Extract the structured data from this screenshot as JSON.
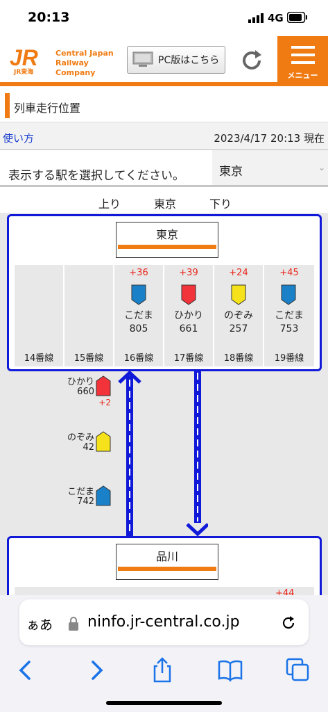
{
  "status": {
    "time": "20:13",
    "network": "4G"
  },
  "header": {
    "logo_text": "JR",
    "logo_sub": "JR東海",
    "company_line1": "Central Japan",
    "company_line2": "Railway Company",
    "pc_button": "PC版はこちら",
    "menu_label": "メニュー"
  },
  "page_title": "列車走行位置",
  "infobar": {
    "how_to": "使い方",
    "updated": "2023/4/17 20:13 現在"
  },
  "select": {
    "label": "表示する駅を選択してください。",
    "value": "東京"
  },
  "directions": {
    "up": "上り",
    "station": "東京",
    "down": "下り"
  },
  "stations": [
    {
      "name": "東京",
      "platforms": [
        {
          "label": "14番線"
        },
        {
          "label": "15番線"
        },
        {
          "label": "16番線",
          "delay": "+36",
          "train": "こだま",
          "number": "805",
          "color": "#1a80c8"
        },
        {
          "label": "17番線",
          "delay": "+39",
          "train": "ひかり",
          "number": "661",
          "color": "#f2333a"
        },
        {
          "label": "18番線",
          "delay": "+24",
          "train": "のぞみ",
          "number": "257",
          "color": "#f5e21a"
        },
        {
          "label": "19番線",
          "delay": "+45",
          "train": "こだま",
          "number": "753",
          "color": "#1a80c8"
        }
      ]
    },
    {
      "name": "品川",
      "partial_delay": "+44"
    }
  ],
  "running_trains": [
    {
      "train": "ひかり",
      "number": "660",
      "delay": "+2",
      "color": "#f2333a"
    },
    {
      "train": "のぞみ",
      "number": "42",
      "color": "#f5e21a"
    },
    {
      "train": "こだま",
      "number": "742",
      "color": "#1a80c8"
    }
  ],
  "browser": {
    "aa": "ぁあ",
    "url": "ninfo.jr-central.co.jp"
  }
}
